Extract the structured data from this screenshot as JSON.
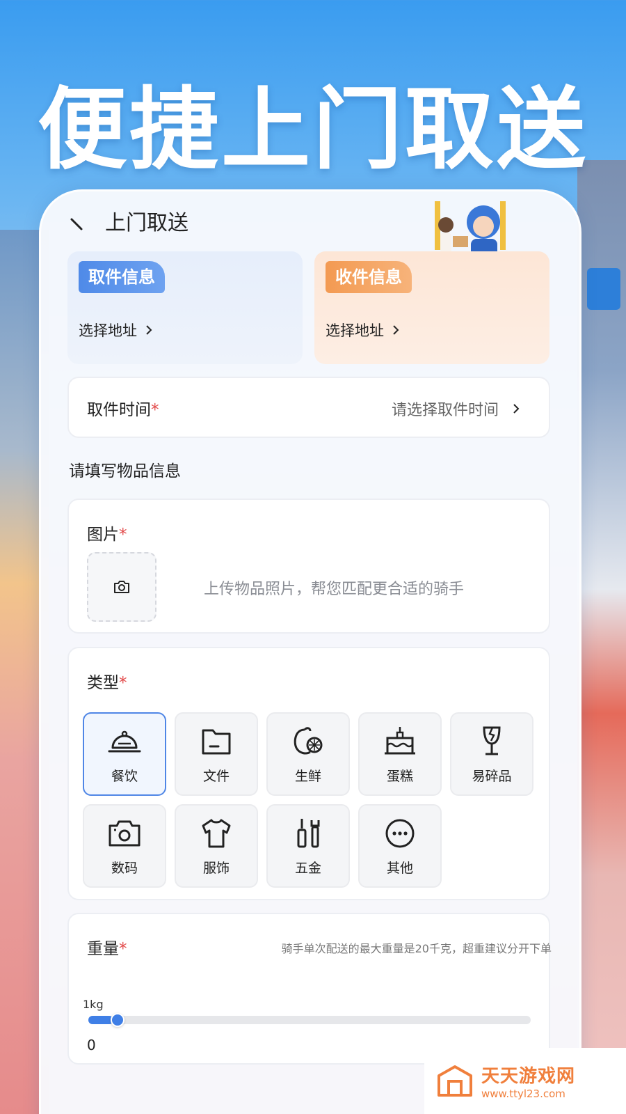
{
  "headline": "便捷上门取送",
  "header": {
    "title": "上门取送"
  },
  "pickup": {
    "tag": "取件信息",
    "select_label": "选择地址"
  },
  "dropoff": {
    "tag": "收件信息",
    "select_label": "选择地址"
  },
  "pickup_time": {
    "label": "取件时间",
    "required": "*",
    "placeholder": "请选择取件时间"
  },
  "item_section": {
    "title": "请填写物品信息"
  },
  "photo": {
    "label": "图片",
    "required": "*",
    "hint": "上传物品照片，帮您匹配更合适的骑手"
  },
  "type": {
    "label": "类型",
    "required": "*",
    "selected": "餐饮",
    "items": [
      {
        "name": "餐饮",
        "icon": "food-cloche-icon"
      },
      {
        "name": "文件",
        "icon": "folder-icon"
      },
      {
        "name": "生鲜",
        "icon": "fresh-produce-icon"
      },
      {
        "name": "蛋糕",
        "icon": "cake-icon"
      },
      {
        "name": "易碎品",
        "icon": "fragile-glass-icon"
      },
      {
        "name": "数码",
        "icon": "camera-icon"
      },
      {
        "name": "服饰",
        "icon": "tshirt-icon"
      },
      {
        "name": "五金",
        "icon": "tools-icon"
      },
      {
        "name": "其他",
        "icon": "more-icon"
      }
    ]
  },
  "weight": {
    "label": "重量",
    "required": "*",
    "note": "骑手单次配送的最大重量是20千克，超重建议分开下单",
    "tick_label": "1kg",
    "value": "0",
    "slider_fraction": 0.05
  },
  "watermark": {
    "name": "天天游戏网",
    "url": "www.ttyl23.com"
  },
  "colors": {
    "accent": "#3f7fe6",
    "pickup_tag": "#4f8ae8",
    "dropoff_tag": "#f39a52",
    "required": "#e24a4a"
  }
}
